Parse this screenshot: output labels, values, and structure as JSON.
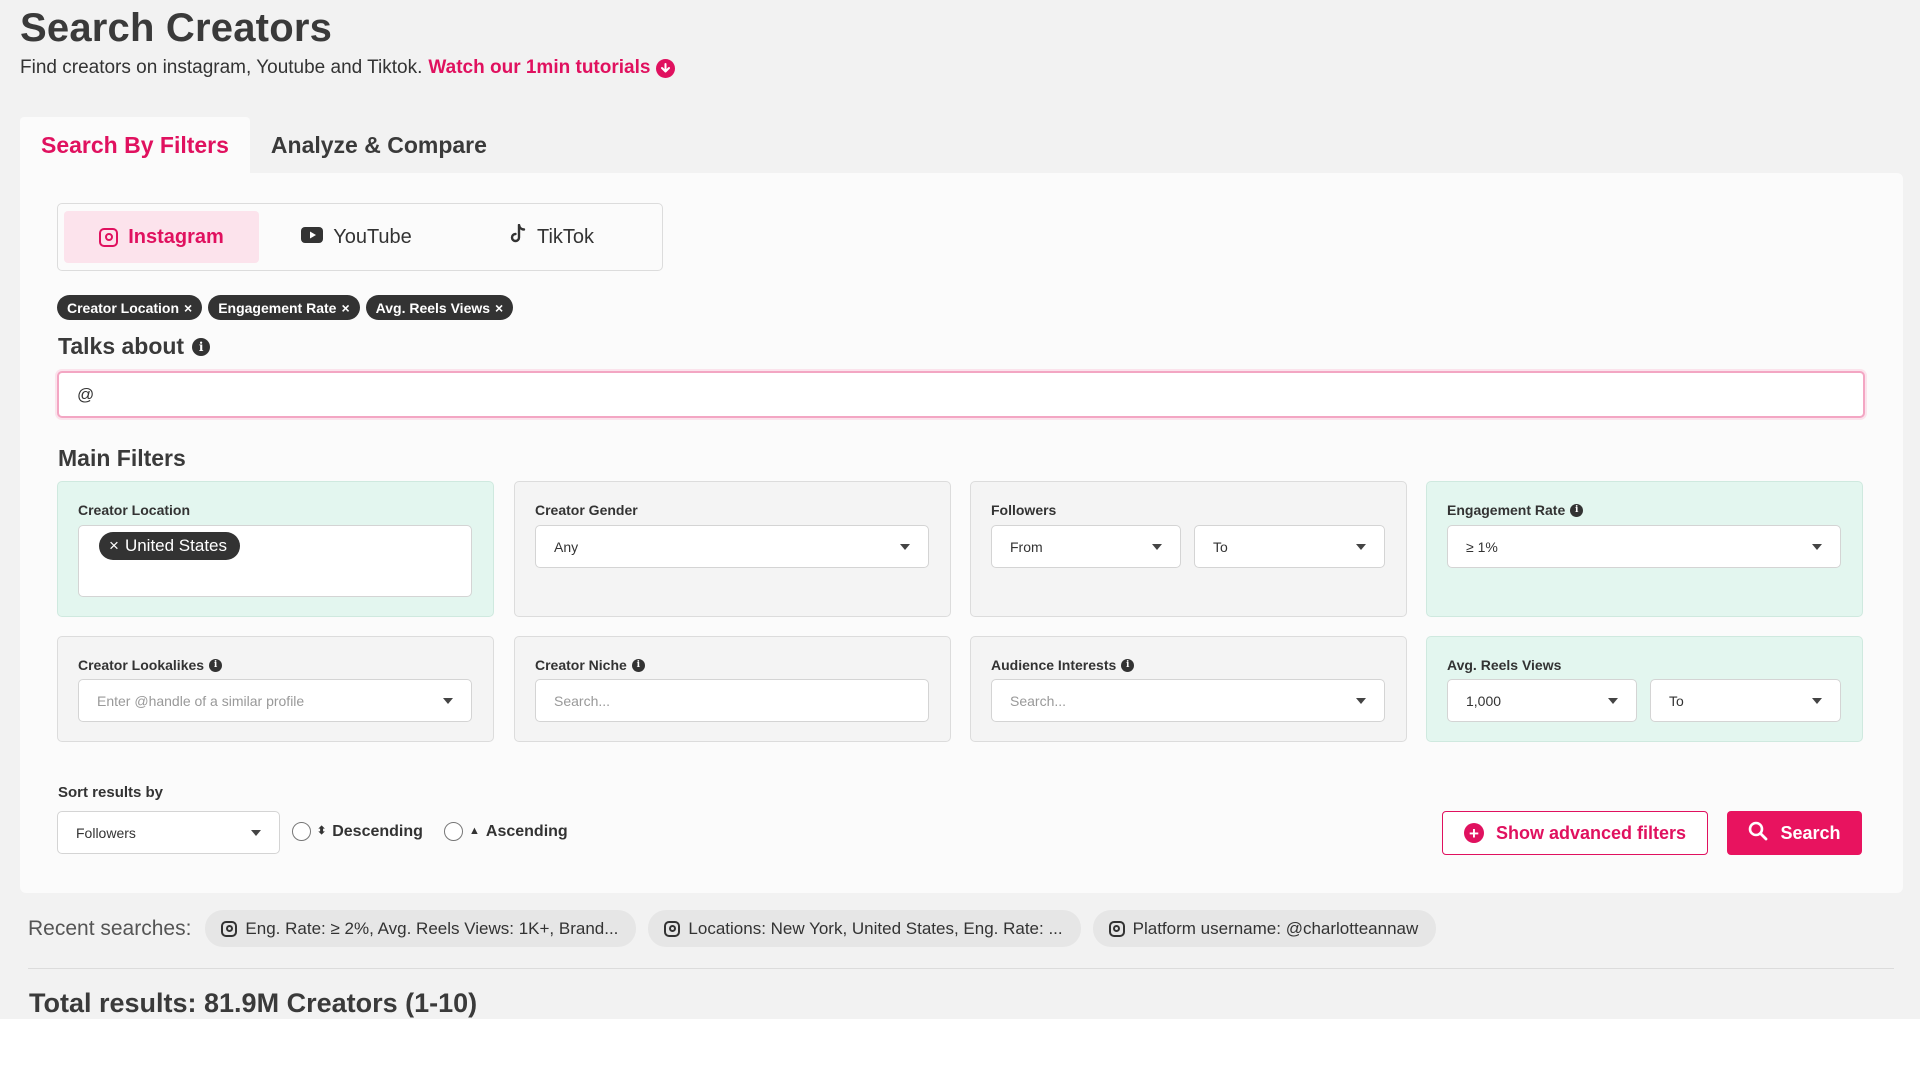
{
  "header": {
    "title": "Search Creators",
    "subtitle": "Find creators on instagram, Youtube and Tiktok.",
    "tutorial_link": "Watch our 1min tutorials"
  },
  "tabs": [
    {
      "label": "Search By Filters",
      "active": true
    },
    {
      "label": "Analyze & Compare",
      "active": false
    }
  ],
  "platforms": [
    {
      "label": "Instagram",
      "icon": "instagram-icon",
      "active": true
    },
    {
      "label": "YouTube",
      "icon": "youtube-icon",
      "active": false
    },
    {
      "label": "TikTok",
      "icon": "tiktok-icon",
      "active": false
    }
  ],
  "active_filters": [
    "Creator Location",
    "Engagement Rate",
    "Avg. Reels Views"
  ],
  "talks_about": {
    "label": "Talks about",
    "value": "@"
  },
  "main_filters": {
    "heading": "Main Filters",
    "creator_location": {
      "label": "Creator Location",
      "selected": "United States"
    },
    "creator_gender": {
      "label": "Creator Gender",
      "value": "Any"
    },
    "followers": {
      "label": "Followers",
      "from": "From",
      "to": "To"
    },
    "engagement_rate": {
      "label": "Engagement Rate",
      "value": "≥ 1%"
    },
    "creator_lookalikes": {
      "label": "Creator Lookalikes",
      "placeholder": "Enter @handle of a similar profile"
    },
    "creator_niche": {
      "label": "Creator Niche",
      "placeholder": "Search..."
    },
    "audience_interests": {
      "label": "Audience Interests",
      "placeholder": "Search..."
    },
    "avg_reels_views": {
      "label": "Avg. Reels Views",
      "from": "1,000",
      "to": "To"
    }
  },
  "sort": {
    "label": "Sort results by",
    "value": "Followers",
    "descending": "Descending",
    "ascending": "Ascending"
  },
  "buttons": {
    "advanced": "Show advanced filters",
    "search": "Search"
  },
  "recent": {
    "label": "Recent searches:",
    "items": [
      "Eng. Rate: ≥ 2%, Avg. Reels Views: 1K+, Brand...",
      "Locations: New York, United States, Eng. Rate: ...",
      "Platform username: @charlotteannaw"
    ]
  },
  "results": {
    "total": "Total results: 81.9M Creators (1-10)"
  },
  "colors": {
    "accent": "#e0115f",
    "highlight_card": "#e3f6ef"
  }
}
